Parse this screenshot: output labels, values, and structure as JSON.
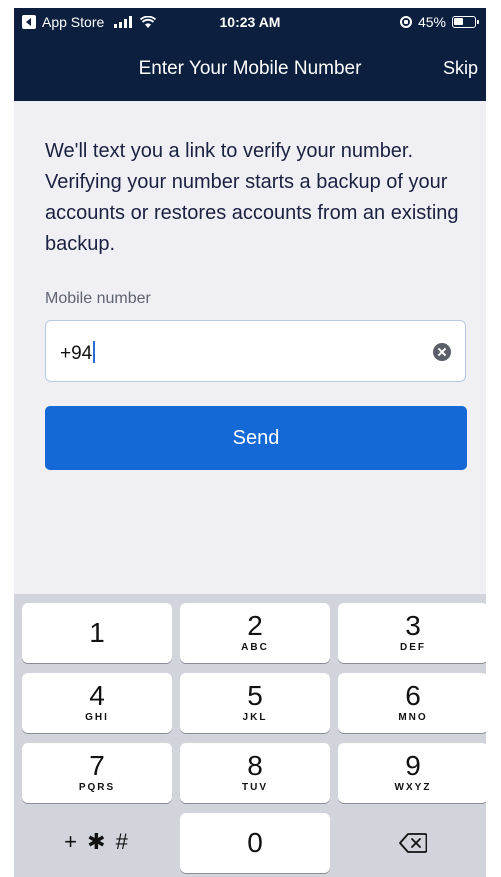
{
  "status_bar": {
    "back_label": "App Store",
    "time": "10:23 AM",
    "battery": "45%"
  },
  "nav": {
    "title": "Enter Your Mobile Number",
    "skip": "Skip"
  },
  "content": {
    "instructions": "We'll text you a link to verify your number. Verifying your number starts a backup of your accounts or restores accounts from an existing backup.",
    "field_label": "Mobile number",
    "field_value": "+94",
    "send_label": "Send"
  },
  "keypad": {
    "keys": [
      {
        "num": "1",
        "letters": ""
      },
      {
        "num": "2",
        "letters": "ABC"
      },
      {
        "num": "3",
        "letters": "DEF"
      },
      {
        "num": "4",
        "letters": "GHI"
      },
      {
        "num": "5",
        "letters": "JKL"
      },
      {
        "num": "6",
        "letters": "MNO"
      },
      {
        "num": "7",
        "letters": "PQRS"
      },
      {
        "num": "8",
        "letters": "TUV"
      },
      {
        "num": "9",
        "letters": "WXYZ"
      }
    ],
    "symbols": "+ ✱ #",
    "zero": "0"
  },
  "colors": {
    "nav_bg": "#0c1f3e",
    "accent": "#1569d6",
    "background": "#f0f0f4"
  }
}
